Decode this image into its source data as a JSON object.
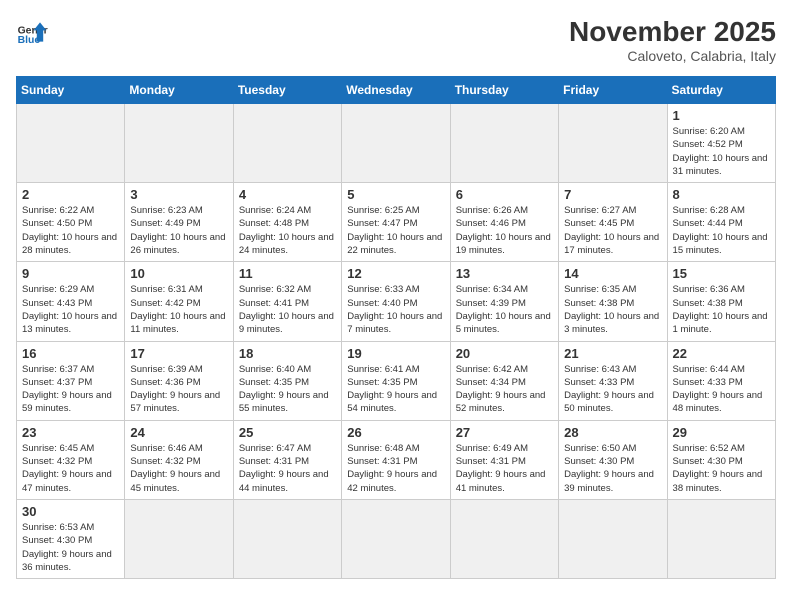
{
  "header": {
    "logo_general": "General",
    "logo_blue": "Blue",
    "month_title": "November 2025",
    "subtitle": "Caloveto, Calabria, Italy"
  },
  "weekdays": [
    "Sunday",
    "Monday",
    "Tuesday",
    "Wednesday",
    "Thursday",
    "Friday",
    "Saturday"
  ],
  "days": [
    {
      "date": "",
      "empty": true
    },
    {
      "date": "",
      "empty": true
    },
    {
      "date": "",
      "empty": true
    },
    {
      "date": "",
      "empty": true
    },
    {
      "date": "",
      "empty": true
    },
    {
      "date": "",
      "empty": true
    },
    {
      "date": "1",
      "sunrise": "6:20 AM",
      "sunset": "4:52 PM",
      "daylight": "10 hours and 31 minutes."
    },
    {
      "date": "2",
      "sunrise": "6:22 AM",
      "sunset": "4:50 PM",
      "daylight": "10 hours and 28 minutes."
    },
    {
      "date": "3",
      "sunrise": "6:23 AM",
      "sunset": "4:49 PM",
      "daylight": "10 hours and 26 minutes."
    },
    {
      "date": "4",
      "sunrise": "6:24 AM",
      "sunset": "4:48 PM",
      "daylight": "10 hours and 24 minutes."
    },
    {
      "date": "5",
      "sunrise": "6:25 AM",
      "sunset": "4:47 PM",
      "daylight": "10 hours and 22 minutes."
    },
    {
      "date": "6",
      "sunrise": "6:26 AM",
      "sunset": "4:46 PM",
      "daylight": "10 hours and 19 minutes."
    },
    {
      "date": "7",
      "sunrise": "6:27 AM",
      "sunset": "4:45 PM",
      "daylight": "10 hours and 17 minutes."
    },
    {
      "date": "8",
      "sunrise": "6:28 AM",
      "sunset": "4:44 PM",
      "daylight": "10 hours and 15 minutes."
    },
    {
      "date": "9",
      "sunrise": "6:29 AM",
      "sunset": "4:43 PM",
      "daylight": "10 hours and 13 minutes."
    },
    {
      "date": "10",
      "sunrise": "6:31 AM",
      "sunset": "4:42 PM",
      "daylight": "10 hours and 11 minutes."
    },
    {
      "date": "11",
      "sunrise": "6:32 AM",
      "sunset": "4:41 PM",
      "daylight": "10 hours and 9 minutes."
    },
    {
      "date": "12",
      "sunrise": "6:33 AM",
      "sunset": "4:40 PM",
      "daylight": "10 hours and 7 minutes."
    },
    {
      "date": "13",
      "sunrise": "6:34 AM",
      "sunset": "4:39 PM",
      "daylight": "10 hours and 5 minutes."
    },
    {
      "date": "14",
      "sunrise": "6:35 AM",
      "sunset": "4:38 PM",
      "daylight": "10 hours and 3 minutes."
    },
    {
      "date": "15",
      "sunrise": "6:36 AM",
      "sunset": "4:38 PM",
      "daylight": "10 hours and 1 minute."
    },
    {
      "date": "16",
      "sunrise": "6:37 AM",
      "sunset": "4:37 PM",
      "daylight": "9 hours and 59 minutes."
    },
    {
      "date": "17",
      "sunrise": "6:39 AM",
      "sunset": "4:36 PM",
      "daylight": "9 hours and 57 minutes."
    },
    {
      "date": "18",
      "sunrise": "6:40 AM",
      "sunset": "4:35 PM",
      "daylight": "9 hours and 55 minutes."
    },
    {
      "date": "19",
      "sunrise": "6:41 AM",
      "sunset": "4:35 PM",
      "daylight": "9 hours and 54 minutes."
    },
    {
      "date": "20",
      "sunrise": "6:42 AM",
      "sunset": "4:34 PM",
      "daylight": "9 hours and 52 minutes."
    },
    {
      "date": "21",
      "sunrise": "6:43 AM",
      "sunset": "4:33 PM",
      "daylight": "9 hours and 50 minutes."
    },
    {
      "date": "22",
      "sunrise": "6:44 AM",
      "sunset": "4:33 PM",
      "daylight": "9 hours and 48 minutes."
    },
    {
      "date": "23",
      "sunrise": "6:45 AM",
      "sunset": "4:32 PM",
      "daylight": "9 hours and 47 minutes."
    },
    {
      "date": "24",
      "sunrise": "6:46 AM",
      "sunset": "4:32 PM",
      "daylight": "9 hours and 45 minutes."
    },
    {
      "date": "25",
      "sunrise": "6:47 AM",
      "sunset": "4:31 PM",
      "daylight": "9 hours and 44 minutes."
    },
    {
      "date": "26",
      "sunrise": "6:48 AM",
      "sunset": "4:31 PM",
      "daylight": "9 hours and 42 minutes."
    },
    {
      "date": "27",
      "sunrise": "6:49 AM",
      "sunset": "4:31 PM",
      "daylight": "9 hours and 41 minutes."
    },
    {
      "date": "28",
      "sunrise": "6:50 AM",
      "sunset": "4:30 PM",
      "daylight": "9 hours and 39 minutes."
    },
    {
      "date": "29",
      "sunrise": "6:52 AM",
      "sunset": "4:30 PM",
      "daylight": "9 hours and 38 minutes."
    },
    {
      "date": "30",
      "sunrise": "6:53 AM",
      "sunset": "4:30 PM",
      "daylight": "9 hours and 36 minutes."
    },
    {
      "date": "",
      "empty": true
    },
    {
      "date": "",
      "empty": true
    },
    {
      "date": "",
      "empty": true
    },
    {
      "date": "",
      "empty": true
    },
    {
      "date": "",
      "empty": true
    },
    {
      "date": "",
      "empty": true
    }
  ]
}
